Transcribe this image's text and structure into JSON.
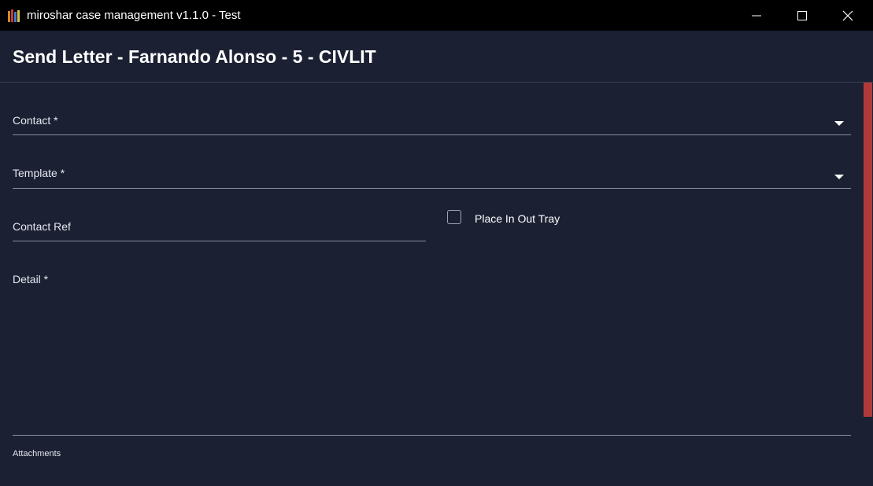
{
  "window": {
    "title": "miroshar case management v1.1.0 - Test",
    "icon": "books-icon",
    "controls": {
      "minimize_icon": "minimize-icon",
      "maximize_icon": "maximize-icon",
      "close_icon": "close-icon"
    }
  },
  "header": {
    "title": "Send Letter - Farnando Alonso - 5 - CIVLIT"
  },
  "form": {
    "contact": {
      "label": "Contact *",
      "value": ""
    },
    "template": {
      "label": "Template *",
      "value": ""
    },
    "contact_ref": {
      "label": "Contact Ref",
      "value": ""
    },
    "place_in_out_tray": {
      "label": "Place In Out Tray",
      "checked": false
    },
    "detail": {
      "label": "Detail *",
      "value": ""
    },
    "attachments": {
      "label": "Attachments"
    }
  },
  "colors": {
    "background": "#1b2033",
    "titlebar": "#000000",
    "scrollbar_thumb": "#b03a3a",
    "underline": "#8a8fa3"
  }
}
